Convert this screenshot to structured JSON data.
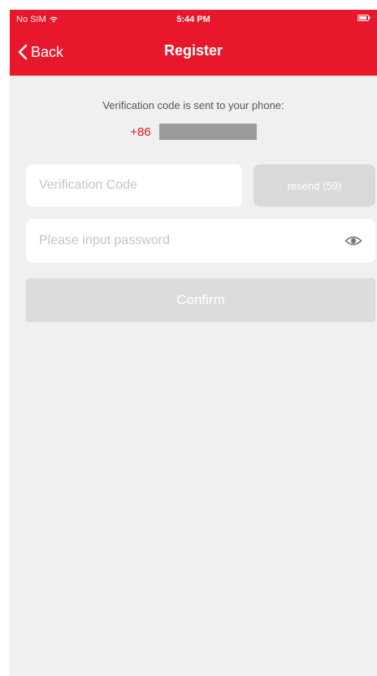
{
  "status_bar": {
    "carrier": "No SIM",
    "time": "5:44 PM"
  },
  "nav": {
    "back_label": "Back",
    "title": "Register"
  },
  "notice": "Verification code is sent to your phone:",
  "phone": {
    "country_code": "+86",
    "number_masked": true
  },
  "code_input": {
    "placeholder": "Verification Code",
    "value": ""
  },
  "resend_button": {
    "label": "resend (59)"
  },
  "password_input": {
    "placeholder": "Please input password",
    "value": ""
  },
  "confirm_button": {
    "label": "Confirm"
  },
  "colors": {
    "brand": "#e8172b",
    "background": "#f0f0f0",
    "disabled_button": "#dcdcdc"
  },
  "icons": [
    "wifi-icon",
    "battery-icon",
    "chevron-left-icon",
    "eye-icon"
  ]
}
